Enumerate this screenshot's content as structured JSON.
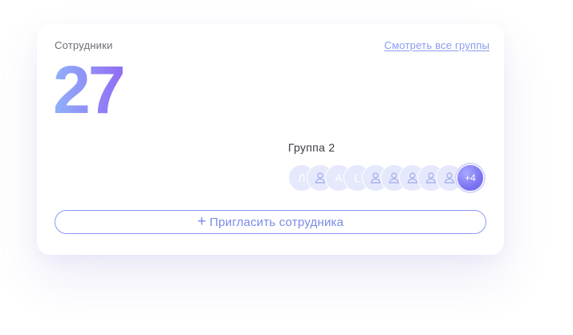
{
  "card": {
    "title": "Сотрудники",
    "view_all_link": "Смотреть все группы",
    "count": "27"
  },
  "group": {
    "name": "Группа 2",
    "members": [
      {
        "type": "initial",
        "label": "Л"
      },
      {
        "type": "icon",
        "icon": "user-icon"
      },
      {
        "type": "initial",
        "label": "A"
      },
      {
        "type": "initial",
        "label": "L"
      },
      {
        "type": "icon",
        "icon": "user-icon"
      },
      {
        "type": "icon",
        "icon": "user-icon"
      },
      {
        "type": "icon",
        "icon": "user-icon"
      },
      {
        "type": "icon",
        "icon": "user-icon"
      },
      {
        "type": "icon",
        "icon": "user-icon"
      }
    ],
    "more_label": "+4"
  },
  "invite_button": {
    "icon": "plus-icon",
    "plus": "+",
    "label": "Пригласить сотрудника"
  },
  "colors": {
    "accent": "#8a9cf2",
    "count_gradient_start": "#8fb2f8",
    "count_gradient_end": "#8f6df3",
    "avatar_bg": "#e6e9fc"
  }
}
